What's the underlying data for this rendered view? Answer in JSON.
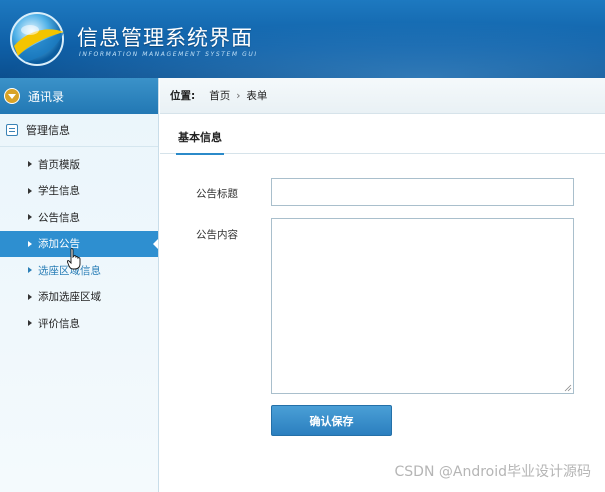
{
  "header": {
    "title": "信息管理系统界面",
    "subtitle": "INFORMATION MANAGEMENT SYSTEM GUI",
    "logo_icon": "globe-logo-icon"
  },
  "sidebar": {
    "section_title": "通讯录",
    "group_title": "管理信息",
    "items": [
      {
        "label": "首页模版"
      },
      {
        "label": "学生信息"
      },
      {
        "label": "公告信息"
      },
      {
        "label": "添加公告"
      },
      {
        "label": "选座区域信息"
      },
      {
        "label": "添加选座区域"
      },
      {
        "label": "评价信息"
      }
    ],
    "active_index": 3
  },
  "breadcrumb": {
    "label": "位置:",
    "items": [
      "首页",
      "表单"
    ],
    "separator": "›"
  },
  "tabs": [
    {
      "label": "基本信息"
    }
  ],
  "form": {
    "title_label": "公告标题",
    "title_value": "",
    "content_label": "公告内容",
    "content_value": "",
    "submit_label": "确认保存"
  },
  "watermark": "CSDN @Android毕业设计源码",
  "colors": {
    "header": "#1467b0",
    "accent": "#2e8fd0",
    "sidebar_bg": "#eaf5fb"
  }
}
